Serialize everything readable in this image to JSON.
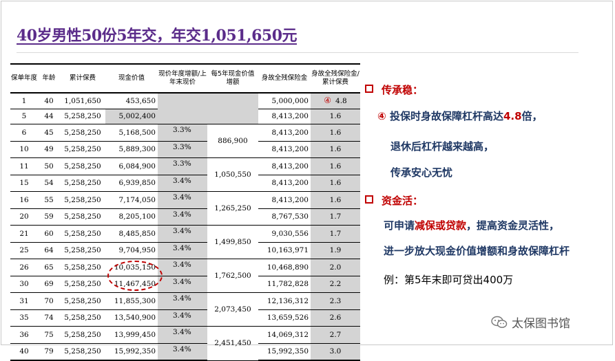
{
  "title": "40岁男性50份5年交，年交1,051,650元",
  "table": {
    "headers": [
      "保单年度",
      "年龄",
      "累计保费",
      "现金价值",
      "现价年度增额/上年末现价",
      "每5年现金价值增额",
      "身故全残保险金",
      "身故全残保险金/累计保费"
    ],
    "rows": [
      {
        "year": "1",
        "age": "40",
        "premium": "1,051,650",
        "cash": "453,650",
        "growth": "",
        "inc5": "",
        "benefit": "5,000,000",
        "mult": "4.8"
      },
      {
        "year": "5",
        "age": "44",
        "premium": "5,258,250",
        "cash": "5,002,400",
        "growth": "",
        "inc5": "",
        "benefit": "8,413,200",
        "mult": "1.6"
      },
      {
        "year": "6",
        "age": "45",
        "premium": "5,258,250",
        "cash": "5,168,500",
        "growth": "3.3%",
        "inc5": "",
        "benefit": "8,413,200",
        "mult": "1.6"
      },
      {
        "year": "10",
        "age": "49",
        "premium": "5,258,250",
        "cash": "5,889,300",
        "growth": "3.3%",
        "inc5": "",
        "benefit": "8,413,200",
        "mult": "1.6"
      },
      {
        "year": "11",
        "age": "50",
        "premium": "5,258,250",
        "cash": "6,084,900",
        "growth": "3.3%",
        "inc5": "",
        "benefit": "8,413,200",
        "mult": "1.6"
      },
      {
        "year": "15",
        "age": "54",
        "premium": "5,258,250",
        "cash": "6,939,850",
        "growth": "3.4%",
        "inc5": "",
        "benefit": "8,413,200",
        "mult": "1.6"
      },
      {
        "year": "16",
        "age": "55",
        "premium": "5,258,250",
        "cash": "7,174,050",
        "growth": "3.4%",
        "inc5": "",
        "benefit": "8,413,200",
        "mult": "1.6"
      },
      {
        "year": "20",
        "age": "59",
        "premium": "5,258,250",
        "cash": "8,205,100",
        "growth": "3.4%",
        "inc5": "",
        "benefit": "8,767,530",
        "mult": "1.7"
      },
      {
        "year": "21",
        "age": "60",
        "premium": "5,258,250",
        "cash": "8,485,850",
        "growth": "3.4%",
        "inc5": "",
        "benefit": "9,030,556",
        "mult": "1.7"
      },
      {
        "year": "25",
        "age": "64",
        "premium": "5,258,250",
        "cash": "9,704,950",
        "growth": "3.4%",
        "inc5": "",
        "benefit": "10,163,971",
        "mult": "1.9"
      },
      {
        "year": "26",
        "age": "65",
        "premium": "5,258,250",
        "cash": "10,035,150",
        "growth": "3.4%",
        "inc5": "",
        "benefit": "10,468,890",
        "mult": "2.0"
      },
      {
        "year": "30",
        "age": "69",
        "premium": "5,258,250",
        "cash": "11,467,450",
        "growth": "3.4%",
        "inc5": "",
        "benefit": "11,782,828",
        "mult": "2.2"
      },
      {
        "year": "31",
        "age": "70",
        "premium": "5,258,250",
        "cash": "11,855,300",
        "growth": "3.4%",
        "inc5": "",
        "benefit": "12,136,312",
        "mult": "2.3"
      },
      {
        "year": "35",
        "age": "74",
        "premium": "5,258,250",
        "cash": "13,540,900",
        "growth": "3.4%",
        "inc5": "",
        "benefit": "13,659,526",
        "mult": "2.6"
      },
      {
        "year": "36",
        "age": "75",
        "premium": "5,258,250",
        "cash": "13,999,450",
        "growth": "3.4%",
        "inc5": "",
        "benefit": "14,069,312",
        "mult": "2.7"
      },
      {
        "year": "40",
        "age": "79",
        "premium": "5,258,250",
        "cash": "15,992,350",
        "growth": "3.4%",
        "inc5": "",
        "benefit": "15,992,350",
        "mult": "3.0"
      }
    ],
    "inc5_values": [
      "886,900",
      "1,050,550",
      "1,265,250",
      "1,499,850",
      "1,762,500",
      "2,073,450",
      "2,451,450"
    ],
    "marker": "④"
  },
  "right": {
    "heading1": "传承稳：",
    "point_marker": "④",
    "point_text_a": "投保时身故保障杠杆高达",
    "point_highlight": "4.8",
    "point_text_b": "倍，",
    "line2": "退休后杠杆越来越高，",
    "line3": "传承安心无忧",
    "heading2": "资金活：",
    "line4_a": "可申请",
    "line4_highlight": "减保或贷款",
    "line4_b": "，提高资金灵活性，",
    "line5": "进一步放大现金价值增额和身故保障杠杆",
    "example": "例：第5年末即可贷出400万"
  },
  "logo_text": "太保图书馆",
  "colors": {
    "title": "#5b2c8a",
    "accent": "#c00000",
    "navy": "#1f3864",
    "shade": "#d4d4d4"
  }
}
